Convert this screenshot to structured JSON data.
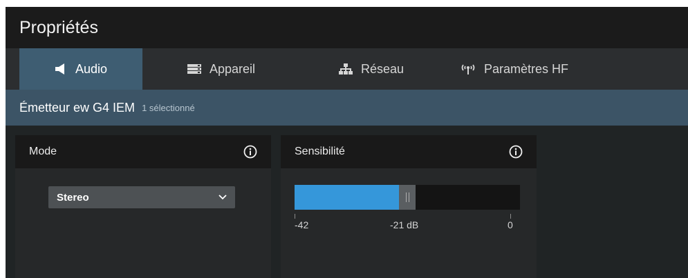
{
  "title": "Propriétés",
  "tabs": [
    {
      "label": "Audio",
      "icon": "speaker-icon",
      "active": true
    },
    {
      "label": "Appareil",
      "icon": "device-icon",
      "active": false
    },
    {
      "label": "Réseau",
      "icon": "network-icon",
      "active": false
    },
    {
      "label": "Paramètres HF",
      "icon": "antenna-icon",
      "active": false
    }
  ],
  "subheader": {
    "device": "Émetteur ew G4 IEM",
    "count": "1 sélectionné"
  },
  "mode_panel": {
    "title": "Mode",
    "selected": "Stereo"
  },
  "sensitivity_panel": {
    "title": "Sensibilité",
    "min": -42,
    "max": 0,
    "value": -21,
    "scale": {
      "min_label": "-42",
      "mid_label": "-21 dB",
      "max_label": "0"
    }
  },
  "colors": {
    "accent": "#3597da",
    "active_tab": "#3e5d72",
    "subheader": "#3c5466",
    "background": "#1f2324"
  }
}
